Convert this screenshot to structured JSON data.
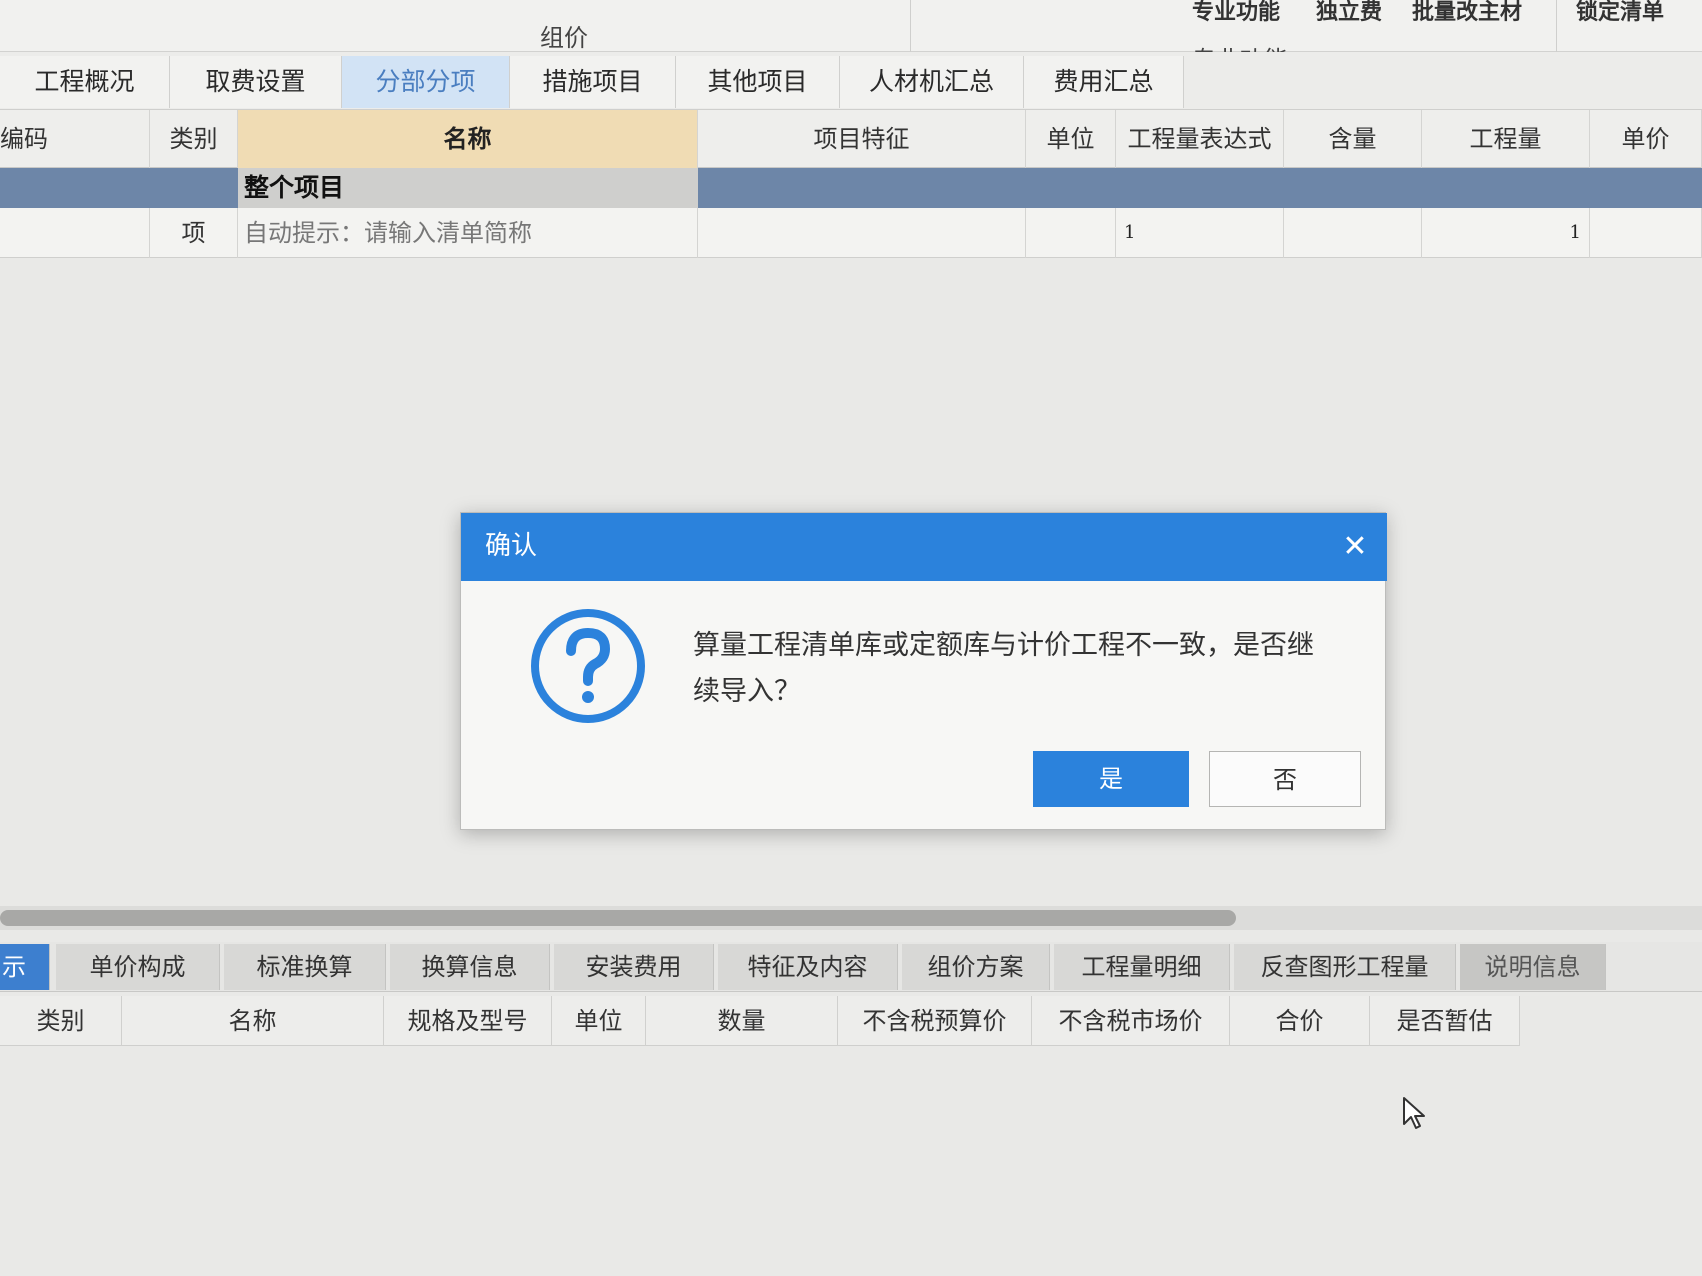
{
  "ribbon": {
    "group_zujia": "组价",
    "group_zhuanye": "专业功能",
    "items": [
      "专业功能",
      "独立费",
      "批量改主材",
      "锁定清单"
    ]
  },
  "main_tabs": [
    {
      "label": "工程概况"
    },
    {
      "label": "取费设置"
    },
    {
      "label": "分部分项",
      "active": true
    },
    {
      "label": "措施项目"
    },
    {
      "label": "其他项目"
    },
    {
      "label": "人材机汇总"
    },
    {
      "label": "费用汇总"
    }
  ],
  "grid": {
    "columns": [
      "编码",
      "类别",
      "名称",
      "项目特征",
      "单位",
      "工程量表达式",
      "含量",
      "工程量",
      "单价"
    ],
    "group_row": {
      "name": "整个项目"
    },
    "rows": [
      {
        "type": "项",
        "name": "自动提示：请输入清单简称",
        "expression": "1",
        "quantity": "1"
      }
    ]
  },
  "dialog": {
    "title": "确认",
    "message": "算量工程清单库或定额库与计价工程不一致，是否继续导入？",
    "yes_label": "是",
    "no_label": "否",
    "icon": "question-circle-icon",
    "accent_color": "#2b82dc"
  },
  "bottom_tabs": [
    {
      "label": "示",
      "active": true
    },
    {
      "label": "单价构成"
    },
    {
      "label": "标准换算"
    },
    {
      "label": "换算信息"
    },
    {
      "label": "安装费用"
    },
    {
      "label": "特征及内容"
    },
    {
      "label": "组价方案"
    },
    {
      "label": "工程量明细"
    },
    {
      "label": "反查图形工程量"
    },
    {
      "label": "说明信息",
      "dim": true
    }
  ],
  "bottom_grid": {
    "columns": [
      "类别",
      "名称",
      "规格及型号",
      "单位",
      "数量",
      "不含税预算价",
      "不含税市场价",
      "合价",
      "是否暂估"
    ]
  }
}
